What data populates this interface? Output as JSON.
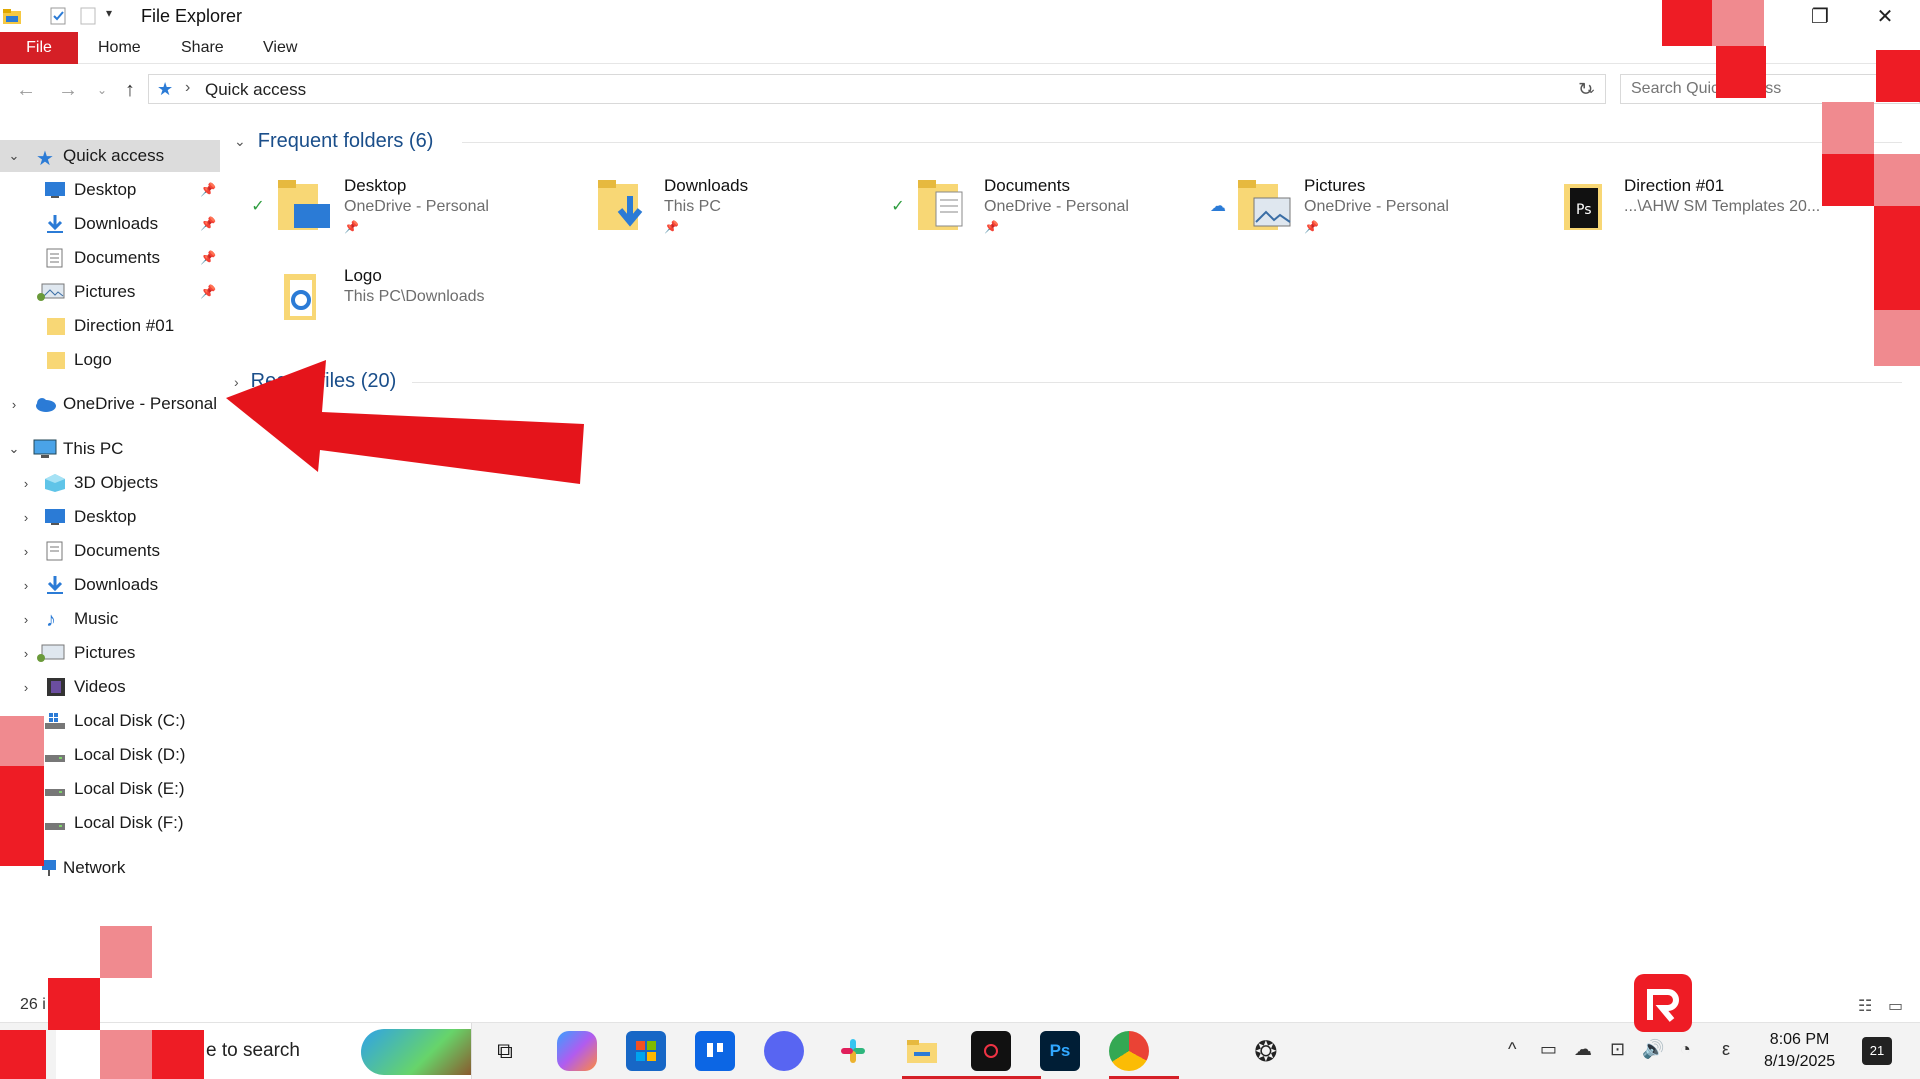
{
  "window": {
    "title": "File Explorer",
    "minimize_label": "—",
    "restore_label": "❐",
    "close_label": "✕"
  },
  "ribbon": {
    "tabs": [
      {
        "label": "File"
      },
      {
        "label": "Home"
      },
      {
        "label": "Share"
      },
      {
        "label": "View"
      }
    ]
  },
  "address": {
    "crumb": "Quick access",
    "search_placeholder": "Search Quick access"
  },
  "sidebar": {
    "quick_access": {
      "label": "Quick access",
      "items": [
        {
          "label": "Desktop",
          "pinned": true
        },
        {
          "label": "Downloads",
          "pinned": true
        },
        {
          "label": "Documents",
          "pinned": true
        },
        {
          "label": "Pictures",
          "pinned": true
        },
        {
          "label": "Direction #01",
          "pinned": false
        },
        {
          "label": "Logo",
          "pinned": false
        }
      ]
    },
    "onedrive": {
      "label": "OneDrive - Personal"
    },
    "this_pc": {
      "label": "This PC",
      "items": [
        {
          "label": "3D Objects"
        },
        {
          "label": "Desktop"
        },
        {
          "label": "Documents"
        },
        {
          "label": "Downloads"
        },
        {
          "label": "Music"
        },
        {
          "label": "Pictures"
        },
        {
          "label": "Videos"
        },
        {
          "label": "Local Disk (C:)"
        },
        {
          "label": "Local Disk (D:)"
        },
        {
          "label": "Local Disk (E:)"
        },
        {
          "label": "Local Disk (F:)"
        }
      ]
    },
    "network": {
      "label": "Network"
    }
  },
  "content": {
    "frequent_title": "Frequent folders (6)",
    "recent_title": "Recent files (20)",
    "folders": [
      {
        "name": "Desktop",
        "location": "OneDrive - Personal",
        "status": "synced",
        "pinned": true
      },
      {
        "name": "Downloads",
        "location": "This PC",
        "status": "",
        "pinned": true
      },
      {
        "name": "Documents",
        "location": "OneDrive - Personal",
        "status": "synced",
        "pinned": true
      },
      {
        "name": "Pictures",
        "location": "OneDrive - Personal",
        "status": "cloud",
        "pinned": true
      },
      {
        "name": "Direction #01",
        "location": "...\\AHW SM Templates 20...",
        "status": "",
        "pinned": false
      },
      {
        "name": "Logo",
        "location": "This PC\\Downloads",
        "status": "",
        "pinned": false
      }
    ]
  },
  "statusbar": {
    "items_count": "26 i"
  },
  "taskbar": {
    "search_placeholder": "e to search",
    "time": "8:06 PM",
    "date": "8/19/2025",
    "notification_count": "21",
    "lang": "ε"
  },
  "colors": {
    "accent_red": "#ee1c25",
    "file_tab": "#d51f26",
    "link_blue": "#1a4e8a",
    "sync_green": "#2e9d3f",
    "cloud_blue": "#2b7bd6"
  }
}
